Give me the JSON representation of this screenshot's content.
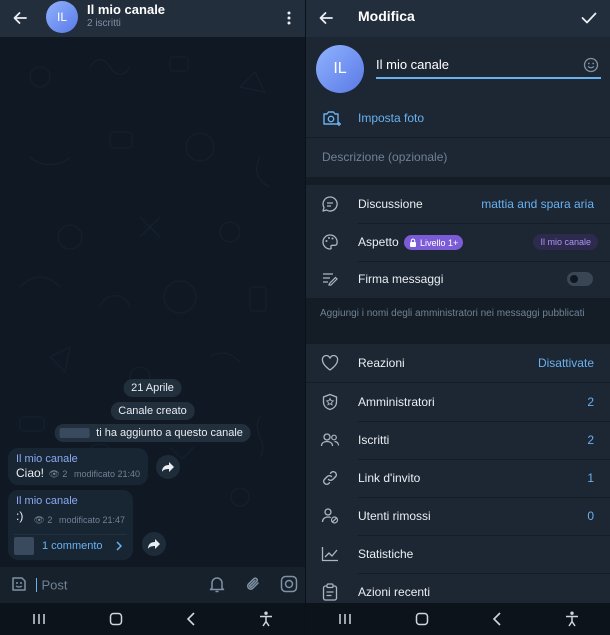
{
  "chat": {
    "title": "Il mio canale",
    "subtitle": "2 iscritti",
    "avatar_initials": "IL",
    "service_date": "21 Aprile",
    "service_created": "Canale creato",
    "service_added": "ti ha aggiunto a questo canale",
    "messages": [
      {
        "author": "Il mio canale",
        "text": "Ciao!",
        "views": "2",
        "time": "modificato 21:40"
      },
      {
        "author": "Il mio canale",
        "text": ":)",
        "views": "2",
        "time": "modificato 21:47",
        "comments": "1 commento"
      }
    ],
    "input_placeholder": "Post"
  },
  "edit": {
    "title": "Modifica",
    "avatar_initials": "IL",
    "name_value": "Il mio canale",
    "set_photo": "Imposta foto",
    "description_placeholder": "Descrizione (opzionale)",
    "discussion_label": "Discussione",
    "discussion_value": "mattia and spara aria",
    "appearance_label": "Aspetto",
    "appearance_badge": "Livello 1+",
    "appearance_value": "Il mio canale",
    "signature_label": "Firma messaggi",
    "signature_hint": "Aggiungi i nomi degli amministratori nei messaggi pubblicati",
    "reactions_label": "Reazioni",
    "reactions_value": "Disattivate",
    "admins_label": "Amministratori",
    "admins_value": "2",
    "subscribers_label": "Iscritti",
    "subscribers_value": "2",
    "invite_label": "Link d'invito",
    "invite_value": "1",
    "removed_label": "Utenti rimossi",
    "removed_value": "0",
    "stats_label": "Statistiche",
    "recent_label": "Azioni recenti"
  },
  "colors": {
    "accent": "#6ab1f0",
    "name_accent": "#8aa9f2",
    "badge": "#7b5cd6",
    "toggle_off": "#3b4654"
  }
}
